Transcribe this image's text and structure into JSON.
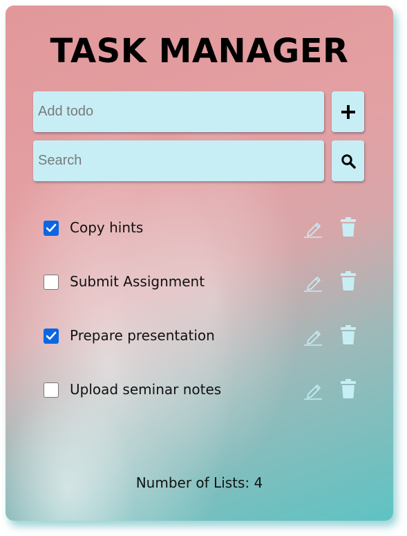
{
  "header": {
    "title": "TASK MANAGER"
  },
  "add": {
    "placeholder": "Add todo",
    "icon": "plus-icon"
  },
  "search": {
    "placeholder": "Search",
    "icon": "search-icon"
  },
  "todos": [
    {
      "label": "Copy hints",
      "checked": true
    },
    {
      "label": "Submit Assignment",
      "checked": false
    },
    {
      "label": "Prepare presentation",
      "checked": true
    },
    {
      "label": "Upload seminar notes",
      "checked": false
    }
  ],
  "footer": {
    "count_text": "Number of Lists: 4"
  },
  "colors": {
    "input_bg": "#c7eef5",
    "checkbox_checked": "#0b66e4",
    "action_icon": "#c7eef5"
  }
}
